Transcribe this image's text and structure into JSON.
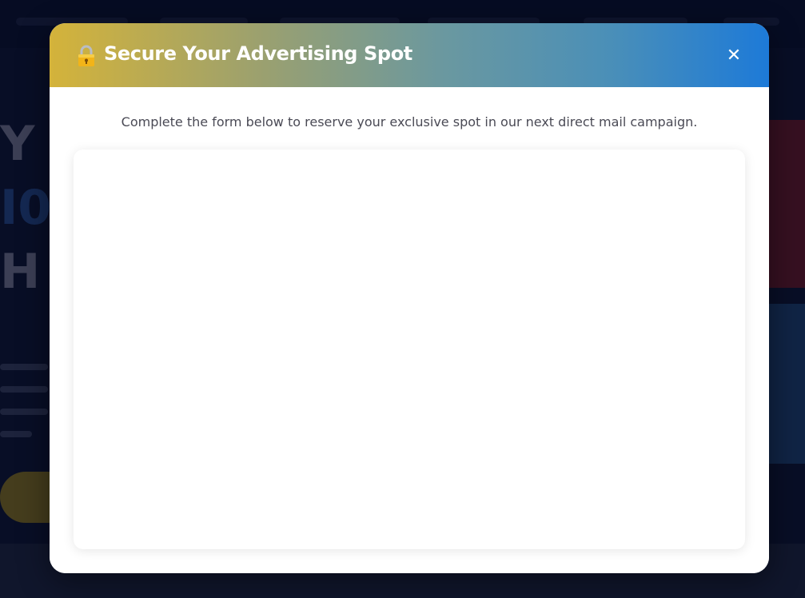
{
  "modal": {
    "title": "Secure Your Advertising Spot",
    "description": "Complete the form below to reserve your exclusive spot in our next direct mail campaign.",
    "close_label": "✕",
    "lock_icon": "lock-icon",
    "header_gradient": [
      "#d4b33a",
      "#1d7ad8"
    ]
  }
}
